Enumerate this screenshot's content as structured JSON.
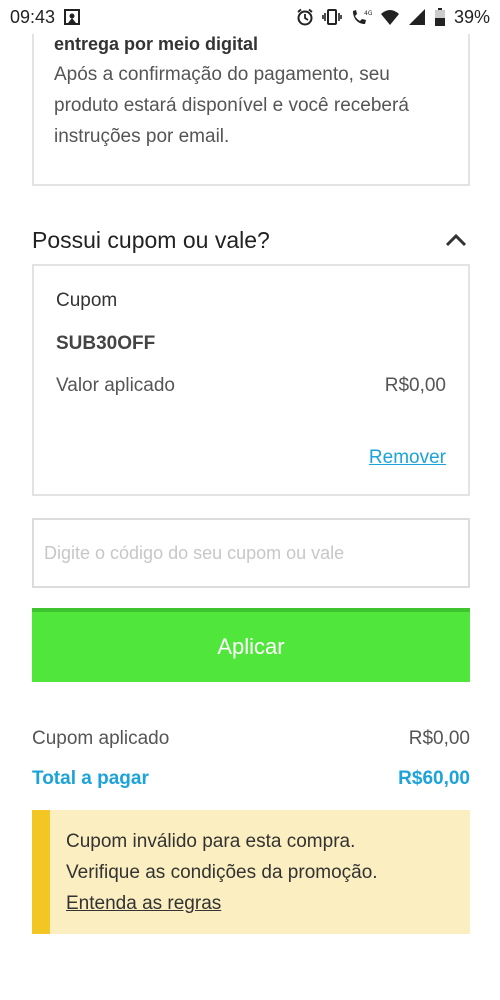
{
  "status_bar": {
    "time": "09:43",
    "battery": "39%",
    "icons": [
      "notification-icon",
      "alarm-icon",
      "vibrate-icon",
      "call-icon",
      "wifi-icon",
      "signal-icon",
      "battery-icon"
    ],
    "network_badge": "4G"
  },
  "delivery": {
    "title": "entrega por meio digital",
    "text": "Após a confirmação do pagamento, seu produto estará disponível e você receberá instruções por email."
  },
  "coupon_section": {
    "heading": "Possui cupom ou vale?",
    "toggle_icon": "chevron-up-icon"
  },
  "coupon_card": {
    "label": "Cupom",
    "code": "SUB30OFF",
    "applied_label": "Valor aplicado",
    "applied_value": "R$0,00",
    "remove_label": "Remover"
  },
  "input": {
    "placeholder": "Digite o código do seu cupom ou vale",
    "value": ""
  },
  "apply_button": {
    "label": "Aplicar"
  },
  "summary": {
    "coupon_label": "Cupom aplicado",
    "coupon_value": "R$0,00",
    "total_label": "Total a pagar",
    "total_value": "R$60,00"
  },
  "alert": {
    "line1": "Cupom inválido para esta compra.",
    "line2": "Verifique as condições da promoção.",
    "link": "Entenda as regras"
  },
  "colors": {
    "accent_blue": "#1ca3d9",
    "button_green": "#50e63c",
    "alert_bg": "#fbeec0",
    "alert_bar": "#f3c623"
  }
}
